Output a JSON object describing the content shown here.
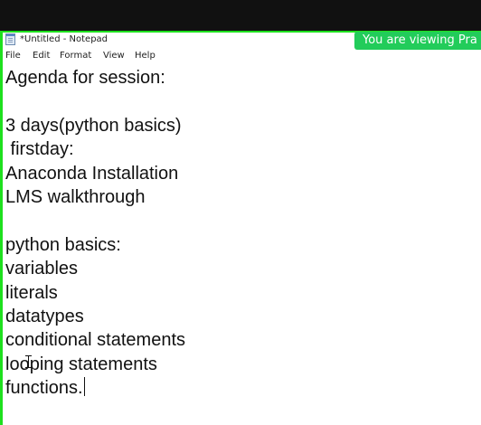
{
  "window": {
    "title": "*Untitled - Notepad"
  },
  "share_banner": {
    "text": "You are viewing Pra"
  },
  "menu": {
    "file": "File",
    "edit": "Edit",
    "format": "Format",
    "view": "View",
    "help": "Help"
  },
  "document": {
    "text": "Agenda for session:\n\n3 days(python basics)\n firstday:\nAnaconda Installation\nLMS walkthrough\n\npython basics:\nvariables\nliterals\ndatatypes\nconditional statements\nlooping statements\nfunctions."
  },
  "colors": {
    "highlight_border": "#1ee01e",
    "banner_background": "#22cc5a",
    "top_band": "#111111"
  },
  "icons": {
    "app_icon": "notepad-icon",
    "cursor": "text-cursor-icon"
  }
}
